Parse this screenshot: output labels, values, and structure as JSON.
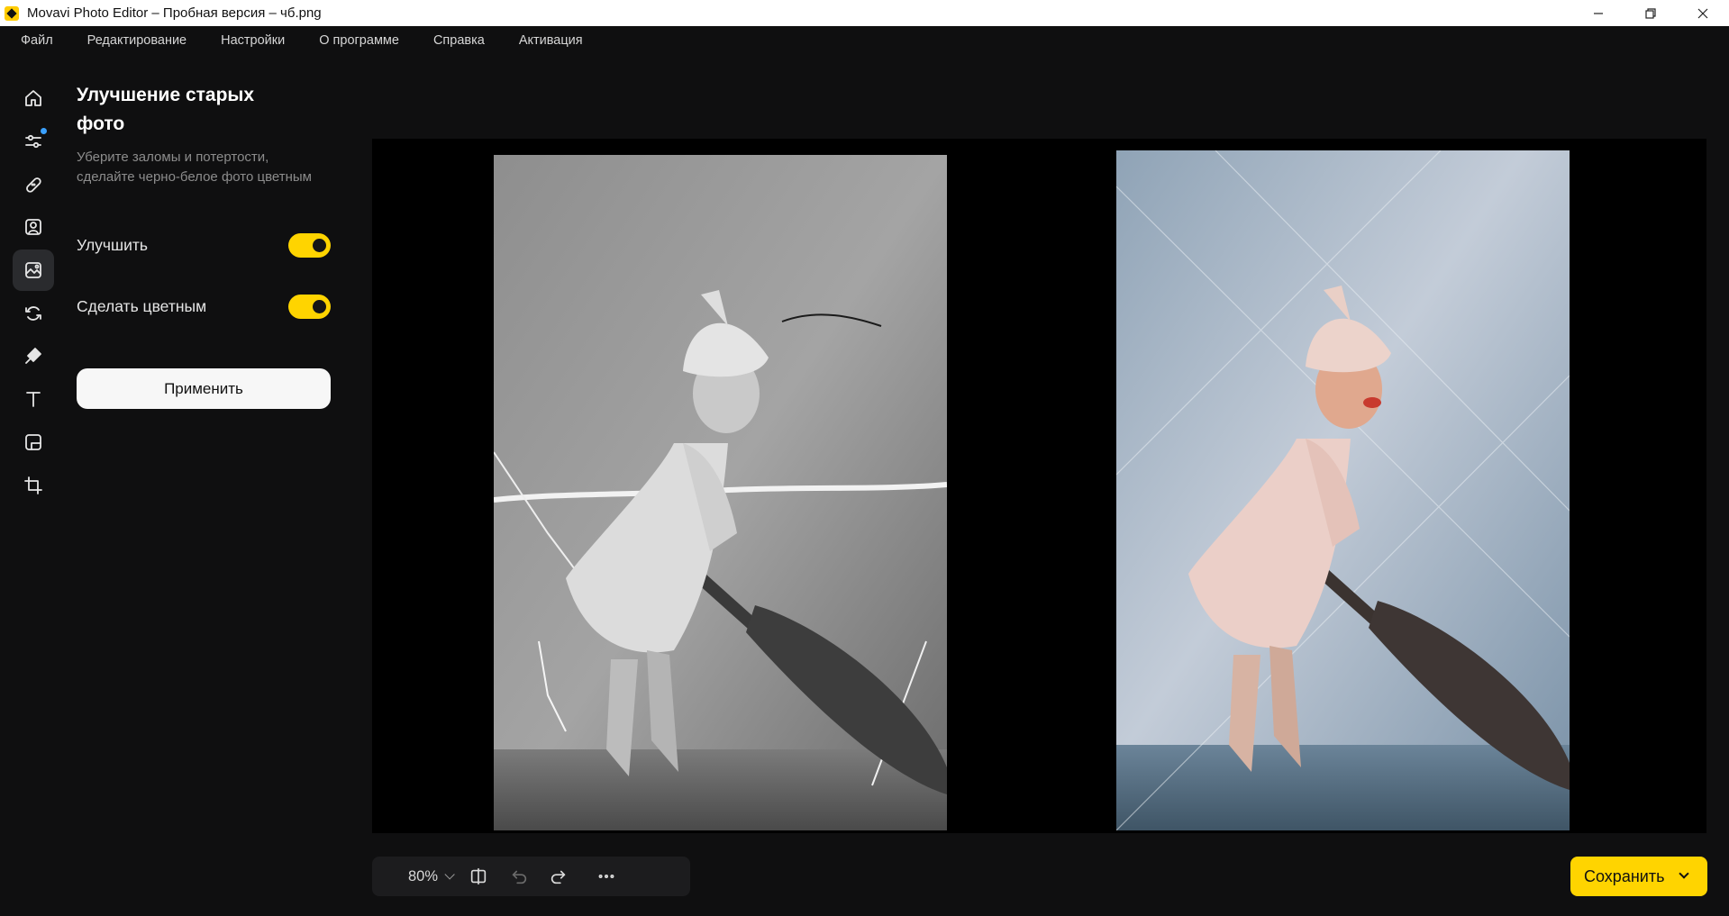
{
  "window": {
    "title": "Movavi Photo Editor – Пробная версия – чб.png",
    "controls": [
      "minimize-icon",
      "restore-icon",
      "close-icon"
    ]
  },
  "menu": {
    "items": [
      "Файл",
      "Редактирование",
      "Настройки",
      "О программе",
      "Справка",
      "Активация"
    ]
  },
  "rail": {
    "items": [
      {
        "icon": "home-icon",
        "active": false
      },
      {
        "icon": "adjust-sliders-icon",
        "active": false,
        "dot": true
      },
      {
        "icon": "retouch-bandage-icon",
        "active": false
      },
      {
        "icon": "portrait-icon",
        "active": false
      },
      {
        "icon": "photo-restore-icon",
        "active": true
      },
      {
        "icon": "replace-background-icon",
        "active": false
      },
      {
        "icon": "erase-object-icon",
        "active": false
      },
      {
        "icon": "text-icon",
        "active": false
      },
      {
        "icon": "frame-icon",
        "active": false
      },
      {
        "icon": "crop-icon",
        "active": false
      }
    ]
  },
  "panel": {
    "title": "Улучшение старых фото",
    "description": "Уберите заломы и потертости, сделайте черно-белое фото цветным",
    "toggles": [
      {
        "label": "Улучшить",
        "on": true
      },
      {
        "label": "Сделать цветным",
        "on": true
      }
    ],
    "apply_label": "Применить"
  },
  "toolbar": {
    "zoom": "80%",
    "icons": [
      "compare-split-icon",
      "undo-icon",
      "redo-icon",
      "more-icon"
    ]
  },
  "save": {
    "label": "Сохранить"
  },
  "colors": {
    "accent": "#ffd400",
    "background": "#0f0f10",
    "panel_button": "#f7f7f7",
    "notification_dot": "#3aa0ff"
  }
}
